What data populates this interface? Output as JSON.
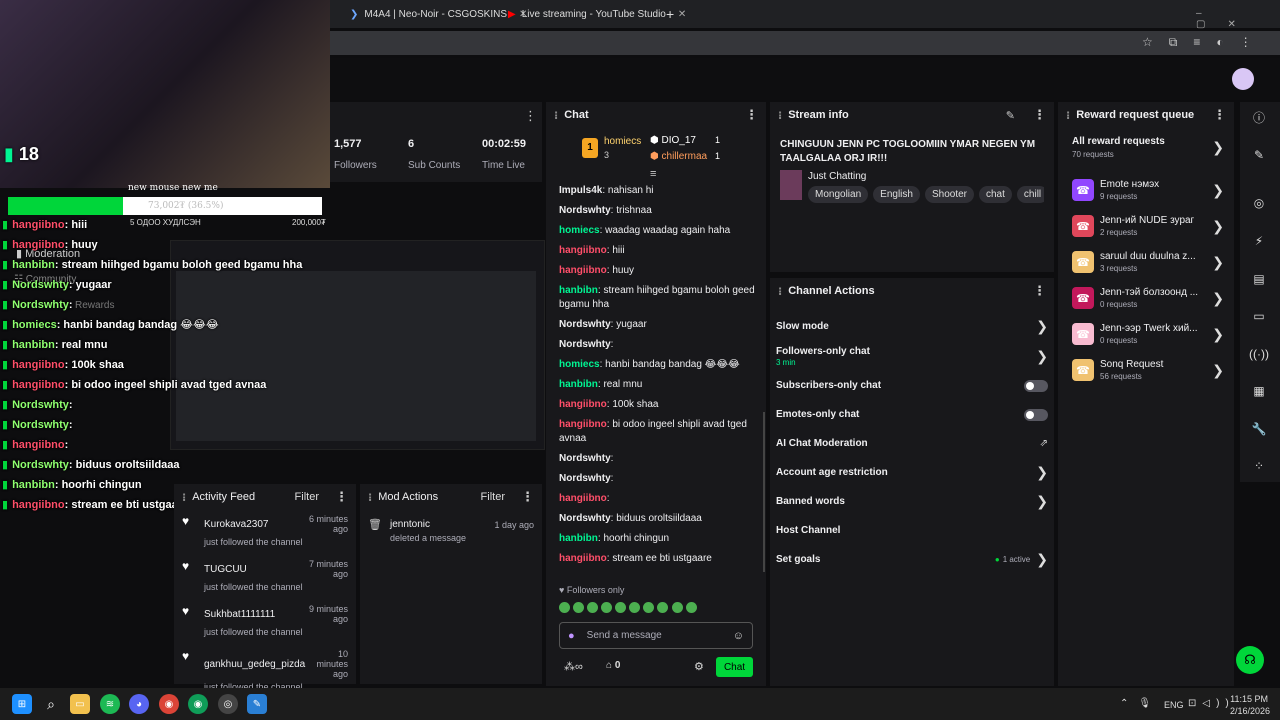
{
  "browser": {
    "tabs": [
      {
        "label": "M4A4 | Neo-Noir - CSGOSKINS"
      },
      {
        "label": "Live streaming - YouTube Studio"
      }
    ],
    "new_tab": "+"
  },
  "overlay": {
    "counter": "18",
    "goal_title": "new mouse new me",
    "goal_progress": "73,002₮ (36.5%)",
    "goal_progress_fraction": 0.365,
    "goal_left": "5 ОДОО ХУДЛСЭН",
    "goal_right": "200,000₮",
    "moderation_label": "Moderation",
    "community_label": "Community",
    "rewards_label": "Rewards",
    "chat": [
      {
        "user": "hangiibno",
        "text": ": hiii",
        "color": "#ff4f6a"
      },
      {
        "user": "hangiibno",
        "text": ": huuy",
        "color": "#ff4f6a"
      },
      {
        "user": "hanbibn",
        "text": ": stream hiihged bgamu boloh geed bgamu hha",
        "color": "#8fff70"
      },
      {
        "user": "Nordswhty",
        "text": ": yugaar",
        "color": "#8fff70"
      },
      {
        "user": "Nordswhty",
        "text": ":",
        "color": "#8fff70"
      },
      {
        "user": "homiecs",
        "text": ": hanbi bandag bandag 😂😂😂",
        "color": "#8fff70"
      },
      {
        "user": "hanbibn",
        "text": ": real mnu",
        "color": "#8fff70"
      },
      {
        "user": "hangiibno",
        "text": ": 100k shaa",
        "color": "#ff4f6a"
      },
      {
        "user": "hangiibno",
        "text": ": bi odoo ingeel shipli avad tged avnaa",
        "color": "#ff4f6a"
      },
      {
        "user": "Nordswhty",
        "text": ":",
        "color": "#8fff70"
      },
      {
        "user": "Nordswhty",
        "text": ":",
        "color": "#8fff70"
      },
      {
        "user": "hangiibno",
        "text": ":",
        "color": "#ff4f6a"
      },
      {
        "user": "Nordswhty",
        "text": ": biduus oroltsiildaaa",
        "color": "#8fff70"
      },
      {
        "user": "hanbibn",
        "text": ": hoorhi chingun",
        "color": "#8fff70"
      },
      {
        "user": "hangiibno",
        "text": ": stream ee bti ustgaare",
        "color": "#ff4f6a"
      }
    ]
  },
  "stats": [
    {
      "value": "1,577",
      "label": "Followers"
    },
    {
      "value": "6",
      "label": "Sub Counts"
    },
    {
      "value": "00:02:59",
      "label": "Time Live"
    }
  ],
  "activity": {
    "title": "Activity Feed",
    "filter": "Filter",
    "items": [
      {
        "name": "Kurokava2307",
        "time": "6 minutes ago",
        "desc": "just followed the channel"
      },
      {
        "name": "TUGCUU",
        "time": "7 minutes ago",
        "desc": "just followed the channel"
      },
      {
        "name": "Sukhbat1111111",
        "time": "9 minutes ago",
        "desc": "just followed the channel"
      },
      {
        "name": "gankhuu_gedeg_pizda",
        "time": "10 minutes ago",
        "desc": "just followed the channel"
      }
    ]
  },
  "mod_actions": {
    "title": "Mod Actions",
    "filter": "Filter",
    "items": [
      {
        "name": "jenntonic",
        "time": "1 day ago",
        "desc": "deleted a message"
      }
    ]
  },
  "chat": {
    "title": "Chat",
    "leaders": [
      {
        "rank": "1",
        "name": "homiecs",
        "count": "3"
      },
      {
        "name": "DIO_17",
        "count": "1"
      },
      {
        "name": "chillermaa",
        "count": "1"
      }
    ],
    "messages": [
      {
        "user": "Impuls4k",
        "text": ": nahisan hi",
        "color": "#efeff1"
      },
      {
        "user": "Nordswhty",
        "text": ": trishnaa",
        "color": "#efeff1"
      },
      {
        "user": "homiecs",
        "text": ": waadag waadag again haha",
        "color": "#00f593"
      },
      {
        "user": "hangiibno",
        "text": ": hiii",
        "color": "#ff4f6a"
      },
      {
        "user": "hangiibno",
        "text": ": huuy",
        "color": "#ff4f6a"
      },
      {
        "user": "hanbibn",
        "text": ": stream hiihged bgamu boloh geed bgamu hha",
        "color": "#00f593"
      },
      {
        "user": "Nordswhty",
        "text": ": yugaar",
        "color": "#efeff1"
      },
      {
        "user": "Nordswhty",
        "text": ":",
        "color": "#efeff1"
      },
      {
        "user": "homiecs",
        "text": ": hanbi bandag bandag 😂😂😂",
        "color": "#00f593"
      },
      {
        "user": "hanbibn",
        "text": ": real mnu",
        "color": "#00f593"
      },
      {
        "user": "hangiibno",
        "text": ": 100k shaa",
        "color": "#ff4f6a"
      },
      {
        "user": "hangiibno",
        "text": ": bi odoo ingeel shipli avad tged avnaa",
        "color": "#ff4f6a"
      },
      {
        "user": "Nordswhty",
        "text": ":",
        "color": "#efeff1"
      },
      {
        "user": "Nordswhty",
        "text": ":",
        "color": "#efeff1"
      },
      {
        "user": "hangiibno",
        "text": ":",
        "color": "#ff4f6a"
      },
      {
        "user": "Nordswhty",
        "text": ": biduus oroltsiildaaa",
        "color": "#efeff1"
      },
      {
        "user": "hanbibn",
        "text": ": hoorhi chingun",
        "color": "#00f593"
      },
      {
        "user": "hangiibno",
        "text": ": stream ee bti ustgaare",
        "color": "#ff4f6a"
      }
    ],
    "followers_only": "Followers only",
    "placeholder": "Send a message",
    "points": "0",
    "send": "Chat"
  },
  "stream_info": {
    "title": "Stream info",
    "stream_title": "CHINGUUN JENN PC TOGLOOMIIN YMAR NEGEN YM TAALGALAA ORJ IR!!!",
    "category": "Just Chatting",
    "tags": [
      "Mongolian",
      "English",
      "Shooter",
      "chat",
      "chill"
    ]
  },
  "channel_actions": {
    "title": "Channel Actions",
    "items": [
      {
        "label": "Slow mode",
        "sub": "",
        "control": "chevron"
      },
      {
        "label": "Followers-only chat",
        "sub": "3 min",
        "control": "chevron"
      },
      {
        "label": "Subscribers-only chat",
        "sub": "",
        "control": "toggle"
      },
      {
        "label": "Emotes-only chat",
        "sub": "",
        "control": "toggle"
      },
      {
        "label": "AI Chat Moderation",
        "sub": "",
        "control": "external"
      },
      {
        "label": "Account age restriction",
        "sub": "",
        "control": "chevron"
      },
      {
        "label": "Banned words",
        "sub": "",
        "control": "chevron"
      },
      {
        "label": "Host Channel",
        "sub": "",
        "control": "none"
      },
      {
        "label": "Set goals",
        "sub": "",
        "control": "chevron",
        "badge": "1 active"
      }
    ]
  },
  "rewards": {
    "title": "Reward request queue",
    "all": {
      "label": "All reward requests",
      "count": "70 requests"
    },
    "items": [
      {
        "label": "Emote нэмэх",
        "count": "9 requests",
        "color": "#9147ff"
      },
      {
        "label": "Jenn-ий NUDE зураг",
        "count": "2 requests",
        "color": "#e0475b"
      },
      {
        "label": "saruul duu duulna z...",
        "count": "3 requests",
        "color": "#f0c270"
      },
      {
        "label": "Jenn-тэй болзоонд ...",
        "count": "0 requests",
        "color": "#c2185b"
      },
      {
        "label": "Jenn-ээр Twerk хий...",
        "count": "0 requests",
        "color": "#f8bbd0"
      },
      {
        "label": "Sonq Request",
        "count": "56 requests",
        "color": "#f0c270"
      }
    ]
  },
  "taskbar": {
    "lang": "ENG",
    "time": "11:15 PM",
    "date": "2/16/2026"
  }
}
